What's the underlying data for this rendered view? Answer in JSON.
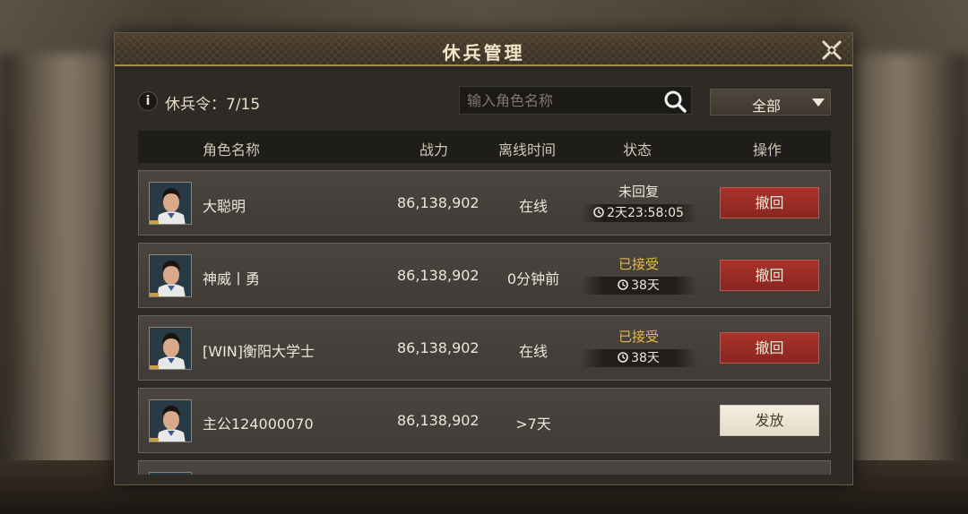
{
  "dialog": {
    "title": "休兵管理",
    "close_icon": "close-x-icon"
  },
  "toolbar": {
    "token_label": "休兵令：7/15",
    "search_placeholder": "输入角色名称",
    "filter_value": "全部"
  },
  "table": {
    "headers": [
      "角色名称",
      "战力",
      "离线时间",
      "状态",
      "操作"
    ],
    "rows": [
      {
        "name": "大聪明",
        "power": "86,138,902",
        "offline": "在线",
        "status": "未回复",
        "status_type": "pending",
        "timer": "2天23:58:05",
        "action": "撤回"
      },
      {
        "name": "神威丨勇",
        "power": "86,138,902",
        "offline": "0分钟前",
        "status": "已接受",
        "status_type": "accepted",
        "timer": "38天",
        "action": "撤回"
      },
      {
        "name": "[WIN]衡阳大学士",
        "power": "86,138,902",
        "offline": "在线",
        "status": "已接受",
        "status_type": "accepted",
        "timer": "38天",
        "action": "撤回"
      },
      {
        "name": "主公124000070",
        "power": "86,138,902",
        "offline": ">7天",
        "status": "",
        "status_type": "none",
        "timer": "",
        "action": "发放"
      }
    ]
  },
  "colors": {
    "accepted": "#e6b84a",
    "recall_button": "#a8332a",
    "issue_button": "#f4eedf"
  }
}
